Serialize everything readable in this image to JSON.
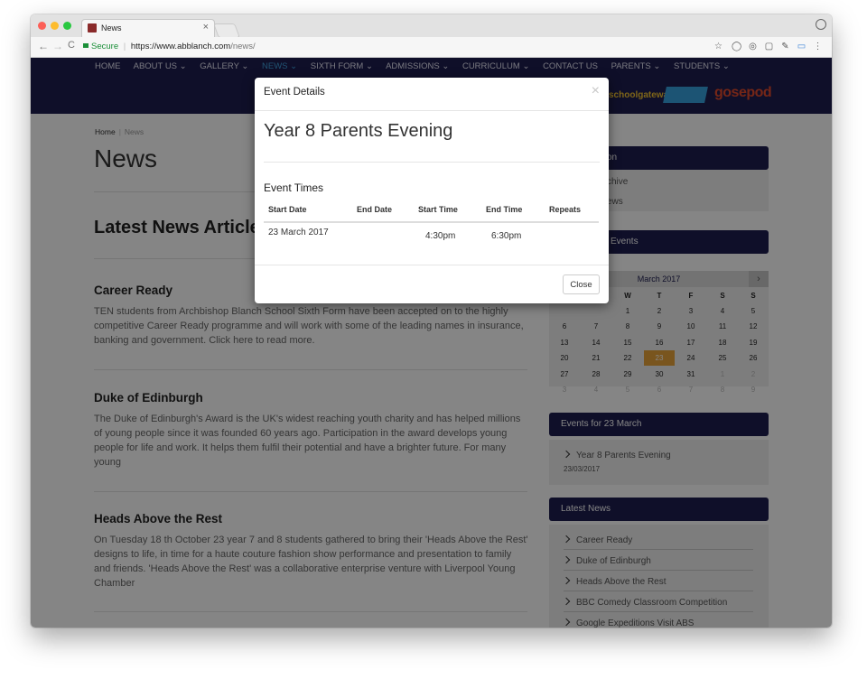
{
  "browser": {
    "tab_title": "News",
    "tab_close": "×",
    "secure_label": "Secure",
    "url_host": "https://www.abblanch.com",
    "url_path": "/news/"
  },
  "nav": {
    "items": [
      "HOME",
      "ABOUT US ⌄",
      "GALLERY ⌄",
      "NEWS ⌄",
      "SIXTH FORM ⌄",
      "ADMISSIONS ⌄",
      "CURRICULUM ⌄",
      "CONTACT US",
      "PARENTS ⌄",
      "STUDENTS ⌄"
    ],
    "active_color": "#3ea0dc"
  },
  "logos": {
    "a": "schoolgateway",
    "b": "gosepod"
  },
  "breadcrumb": {
    "home": "Home",
    "sep": "|",
    "current": "News"
  },
  "page_title": "News",
  "latest_heading": "Latest News Articles",
  "articles": [
    {
      "title": "Career Ready",
      "text": "TEN students from Archbishop Blanch School Sixth Form have been accepted on to the highly competitive Career Ready programme and will work with some of the leading names in insurance, banking and government. Click  here to read more."
    },
    {
      "title": "Duke of Edinburgh",
      "text": "The Duke of Edinburgh's Award is the UK's widest reaching youth charity and has helped millions of young people since it was founded 60 years ago. Participation in the award develops young people for life and work. It helps them fulfil their potential and have a brighter future. For many young"
    },
    {
      "title": "Heads Above the Rest",
      "text": "On Tuesday 18 th October 23 year 7 and 8 students gathered to bring their 'Heads Above the Rest' designs to life, in time for a haute couture fashion show performance and presentation to family and friends. 'Heads Above the Rest' was a collaborative enterprise venture with Liverpool Young Chamber"
    }
  ],
  "sidebar": {
    "nav_head": "on",
    "nav_links": [
      "chive",
      "ews"
    ],
    "events_head": "Events",
    "calendar": {
      "month": "March 2017",
      "next": "›",
      "days": [
        "",
        "",
        "W",
        "T",
        "F",
        "S",
        "S"
      ],
      "rows": [
        [
          "",
          "",
          "1",
          "2",
          "3",
          "4",
          "5"
        ],
        [
          "6",
          "7",
          "8",
          "9",
          "10",
          "11",
          "12"
        ],
        [
          "13",
          "14",
          "15",
          "16",
          "17",
          "18",
          "19"
        ],
        [
          "20",
          "21",
          "22",
          "23",
          "24",
          "25",
          "26"
        ],
        [
          "27",
          "28",
          "29",
          "30",
          "31",
          "1",
          "2"
        ],
        [
          "3",
          "4",
          "5",
          "6",
          "7",
          "8",
          "9"
        ]
      ],
      "today": "23",
      "accent": "#e8a33a"
    },
    "events_for_head": "Events for 23 March",
    "event_link": "Year 8 Parents Evening",
    "event_date": "23/03/2017",
    "latest_head": "Latest News",
    "latest_links": [
      "Career Ready",
      "Duke of Edinburgh",
      "Heads Above the Rest",
      "BBC Comedy Classroom Competition",
      "Google Expeditions Visit ABS"
    ]
  },
  "modal": {
    "header": "Event Details",
    "close_x": "×",
    "event_title": "Year 8 Parents Evening",
    "section": "Event Times",
    "columns": [
      "Start Date",
      "End Date",
      "Start Time",
      "End Time",
      "Repeats"
    ],
    "row": {
      "start_date": "23 March 2017",
      "end_date": "",
      "start_time": "4:30pm",
      "end_time": "6:30pm",
      "repeats": ""
    },
    "close_button": "Close"
  }
}
